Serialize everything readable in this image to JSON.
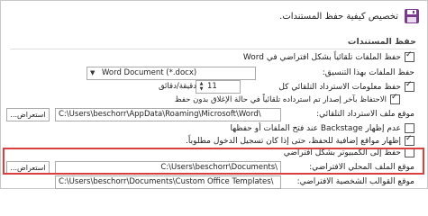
{
  "header": {
    "title": "تخصيص كيفية حفظ المستندات."
  },
  "section": {
    "title": "حفظ المستندات"
  },
  "options": {
    "save_default_label": "حفظ الملفات تلقائياً بشكل افتراضي في Word",
    "save_format_label": "حفظ الملفات بهذا التنسيق:",
    "save_format_value": "Word Document (*.docx)",
    "autorecover_label": "حفظ معلومات الاسترداد التلقائي كل",
    "autorecover_minutes": "11",
    "autorecover_unit": "دقيقة/دقائق",
    "keep_last_label": "الاحتفاظ بآخر إصدار تم استرداده تلقائياً في حالة الإغلاق بدون حفظ",
    "autorecover_location_label": "موقع ملف الاسترداد التلقائي:",
    "autorecover_location_value": "C:\\Users\\beschorr\\AppData\\Roaming\\Microsoft\\Word\\",
    "browse_label": "استعراض...",
    "no_backstage_label": "عدم إظهار Backstage عند فتح الملفات أو حفظها",
    "show_additional_label": "إظهار مواقع إضافية للحفظ، حتى إذا كان تسجيل الدخول مطلوباً.",
    "save_computer_label": "حفظ إلى الكمبيوتر بشكل افتراضي",
    "default_local_label": "موقع الملف المحلي الافتراضي:",
    "default_local_value": "C:\\Users\\beschorr\\Documents\\",
    "templates_label": "موقع القوالب الشخصية الافتراضي:",
    "templates_value": "C:\\Users\\beschorr\\Documents\\Custom Office Templates\\"
  },
  "colors": {
    "highlight": "#d7403d",
    "icon": "#7a3b8c"
  }
}
